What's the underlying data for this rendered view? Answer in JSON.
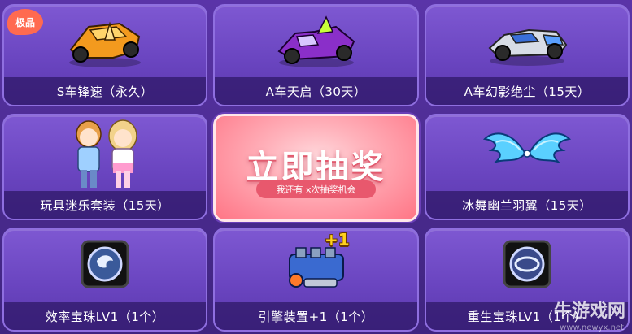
{
  "badge": "极品",
  "center": {
    "title": "立即抽奖",
    "subtitle": "我还有 x次抽奖机会"
  },
  "items": [
    {
      "label": "S车锋速（永久）",
      "icon": "orange-kart-icon"
    },
    {
      "label": "A车天启（30天）",
      "icon": "purple-kart-icon"
    },
    {
      "label": "A车幻影绝尘（15天）",
      "icon": "silver-kart-icon"
    },
    {
      "label": "玩具迷乐套装（15天）",
      "icon": "couple-outfit-icon"
    },
    {
      "label": "冰舞幽兰羽翼（15天）",
      "icon": "blue-wings-icon"
    },
    {
      "label": "效率宝珠LV1（1个）",
      "icon": "efficiency-orb-icon"
    },
    {
      "label": "引擎装置+1（1个）",
      "icon": "engine-icon"
    },
    {
      "label": "重生宝珠LV1（1个）",
      "icon": "rebirth-orb-icon"
    }
  ],
  "engine_plus": "+1",
  "watermark": {
    "text": "牛游戏网",
    "url": "www.newyx.net"
  },
  "colors": {
    "accent": "#ff7585",
    "panel": "#6a45c0",
    "badge": "#ff6a50",
    "plus": "#ffd21e"
  }
}
